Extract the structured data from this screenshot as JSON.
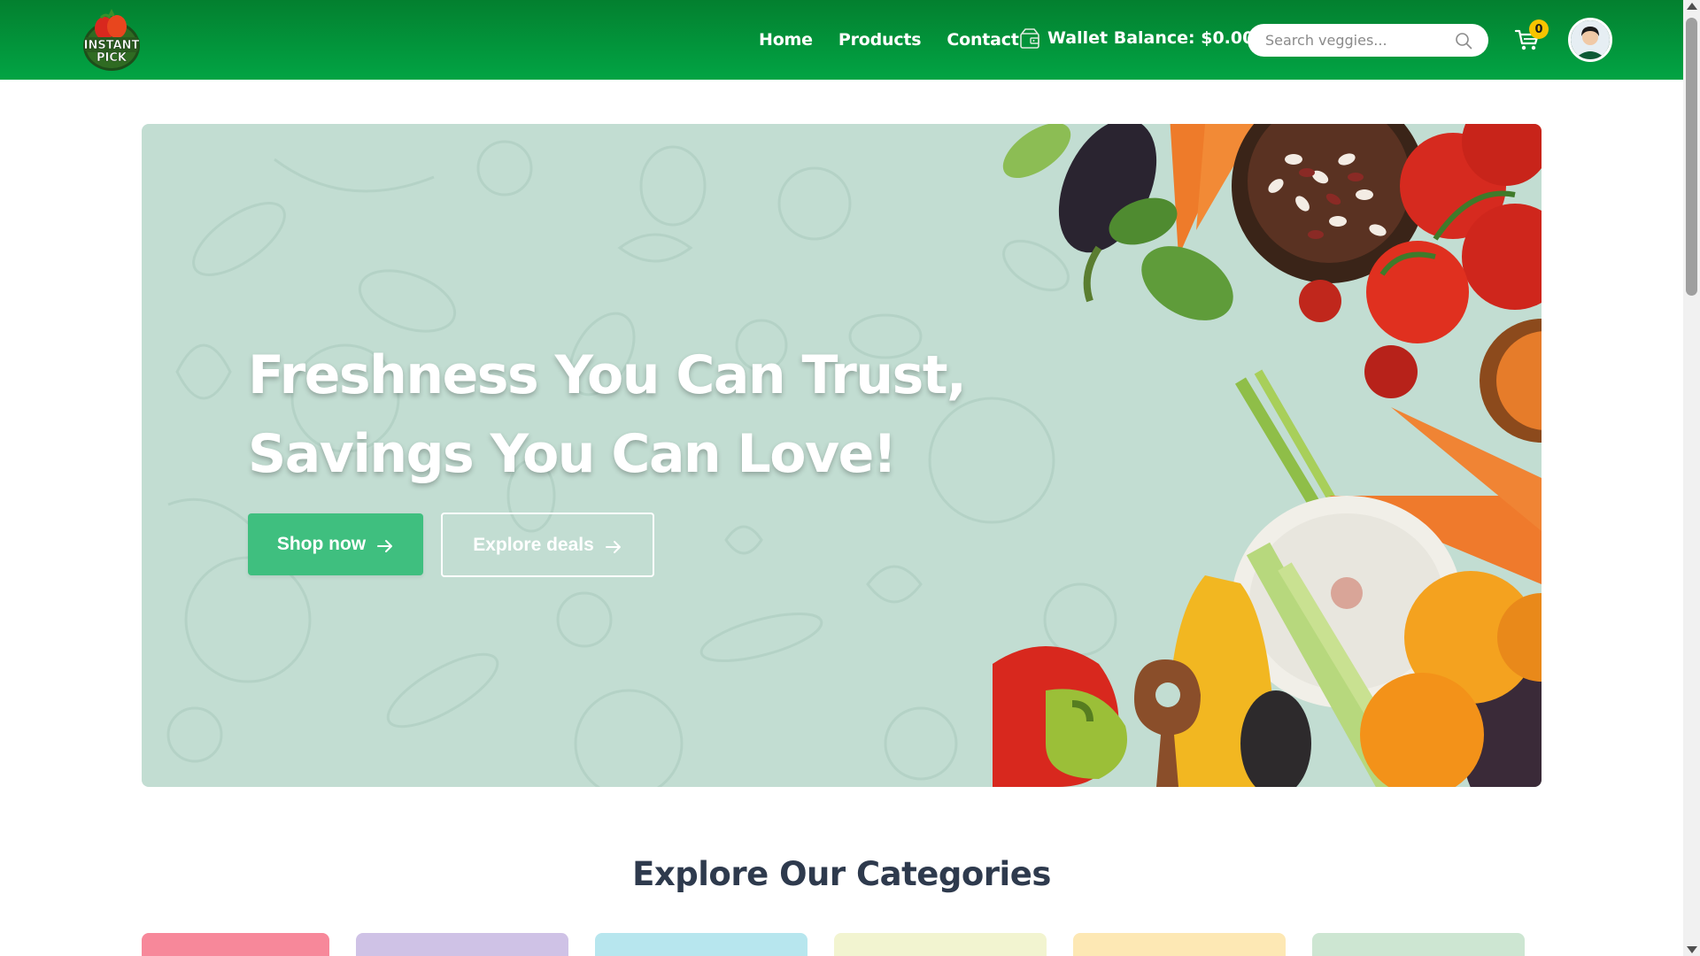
{
  "header": {
    "logo_text_line1": "INSTANT",
    "logo_text_line2": "PICK",
    "nav": [
      {
        "label": "Home"
      },
      {
        "label": "Products"
      },
      {
        "label": "Contact"
      }
    ],
    "wallet_label": "Wallet Balance: $0.00",
    "search_placeholder": "Search veggies...",
    "cart_count": "0"
  },
  "hero": {
    "title_line1": "Freshness You Can Trust,",
    "title_line2": "Savings You Can Love!",
    "shop_button": "Shop now",
    "deals_button": "Explore deals"
  },
  "categories": {
    "title": "Explore Our Categories",
    "card_colors": [
      "#f7889a",
      "#cfc2e6",
      "#b7e6ee",
      "#f2f4d0",
      "#fde8b4",
      "#cde6d2"
    ]
  },
  "colors": {
    "brand_green": "#02a444",
    "header_dark": "#03802f",
    "button_green": "#3fbf7f",
    "hero_bg": "#c2ddd2",
    "badge": "#f7c400"
  }
}
